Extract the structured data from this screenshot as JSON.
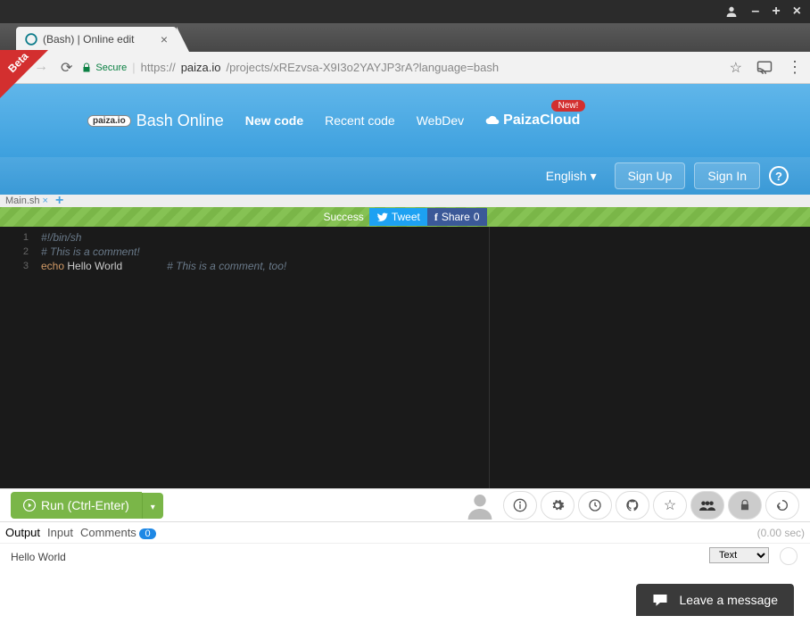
{
  "browser": {
    "tab_title": "(Bash) | Online edit",
    "secure_label": "Secure",
    "url_host": "https://",
    "url_domain": "paiza.io",
    "url_path": "/projects/xREzvsa-X9I3o2YAYJP3rA?language=bash"
  },
  "header": {
    "logo_small": "paiza.io",
    "title": "Bash Online",
    "nav": {
      "new_code": "New code",
      "recent": "Recent code",
      "webdev": "WebDev",
      "cloud": "PaizaCloud",
      "new_badge": "New!"
    },
    "language": "English",
    "sign_up": "Sign Up",
    "sign_in": "Sign In"
  },
  "beta": "Beta",
  "file_tab": "Main.sh",
  "status": {
    "success": "Success",
    "tweet": "Tweet",
    "share": "Share",
    "share_count": "0"
  },
  "code": {
    "lines": [
      "1",
      "2",
      "3"
    ],
    "l1": "#!/bin/sh",
    "l2": "# This is a comment!",
    "l3_cmd": "echo",
    "l3_args": " Hello World",
    "l3_comment": "# This is a comment, too!"
  },
  "toolbar": {
    "run": "Run (Ctrl-Enter)"
  },
  "output": {
    "tab_output": "Output",
    "tab_input": "Input",
    "tab_comments": "Comments",
    "comment_count": "0",
    "timing": "(0.00 sec)",
    "format": "Text",
    "text": "Hello World"
  },
  "chat": "Leave a message"
}
